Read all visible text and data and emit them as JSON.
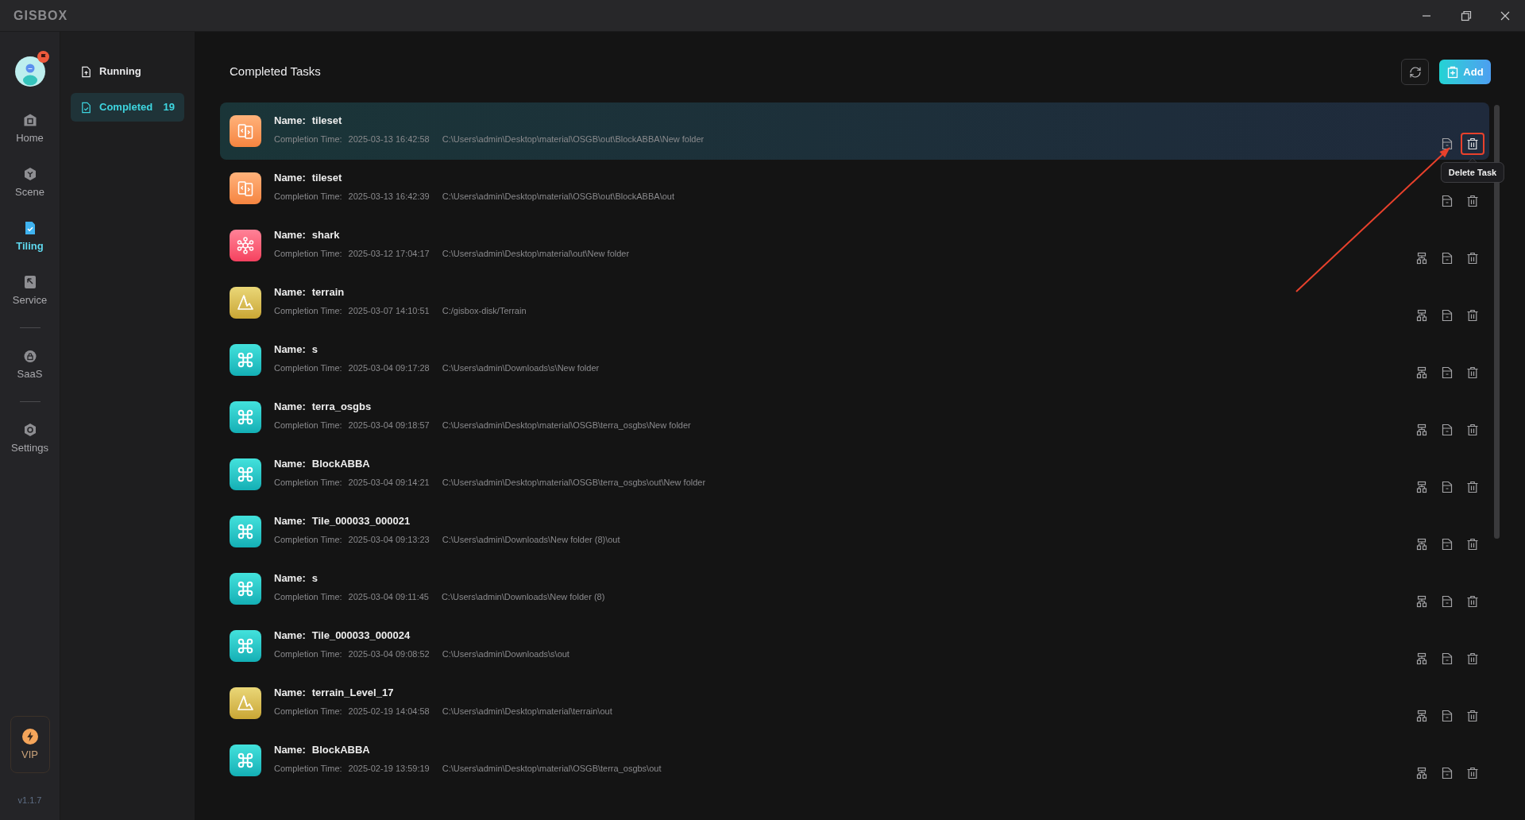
{
  "window": {
    "logo": "GISBOX"
  },
  "nav": {
    "groups": [
      {
        "items": [
          {
            "label": "Home",
            "selected": false
          },
          {
            "label": "Scene",
            "selected": false
          },
          {
            "label": "Tiling",
            "selected": true
          },
          {
            "label": "Service",
            "selected": false
          }
        ]
      },
      {
        "items": [
          {
            "label": "SaaS",
            "selected": false
          }
        ]
      },
      {
        "items": [
          {
            "label": "Settings",
            "selected": false
          }
        ]
      }
    ],
    "vip": "VIP",
    "version": "v1.1.7"
  },
  "task_menu": [
    {
      "label": "Running",
      "selected": false
    },
    {
      "label": "Completed",
      "selected": true,
      "count": "19"
    }
  ],
  "page": {
    "title": "Completed Tasks",
    "add_button": "Add"
  },
  "tasks": [
    {
      "kind": "tileset",
      "selected": true,
      "callout": true,
      "delete_tooltip": "Delete Task",
      "name_label": "Name:",
      "name": "tileset",
      "time_label": "Completion Time:",
      "time": "2025-03-13 16:42:58",
      "path": "C:\\Users\\admin\\Desktop\\material\\OSGB\\out\\BlockABBA\\New folder"
    },
    {
      "kind": "tileset",
      "selected": false,
      "callout": false,
      "name_label": "Name:",
      "name": "tileset",
      "time_label": "Completion Time:",
      "time": "2025-03-13 16:42:39",
      "path": "C:\\Users\\admin\\Desktop\\material\\OSGB\\out\\BlockABBA\\out"
    },
    {
      "kind": "model",
      "selected": false,
      "callout": false,
      "name_label": "Name:",
      "name": "shark",
      "time_label": "Completion Time:",
      "time": "2025-03-12 17:04:17",
      "path": "C:\\Users\\admin\\Desktop\\material\\out\\New folder"
    },
    {
      "kind": "terrain",
      "selected": false,
      "callout": false,
      "name_label": "Name:",
      "name": "terrain",
      "time_label": "Completion Time:",
      "time": "2025-03-07 14:10:51",
      "path": "C:/gisbox-disk/Terrain"
    },
    {
      "kind": "oblique",
      "selected": false,
      "callout": false,
      "name_label": "Name:",
      "name": "s",
      "time_label": "Completion Time:",
      "time": "2025-03-04 09:17:28",
      "path": "C:\\Users\\admin\\Downloads\\s\\New folder"
    },
    {
      "kind": "oblique",
      "selected": false,
      "callout": false,
      "name_label": "Name:",
      "name": "terra_osgbs",
      "time_label": "Completion Time:",
      "time": "2025-03-04 09:18:57",
      "path": "C:\\Users\\admin\\Desktop\\material\\OSGB\\terra_osgbs\\New folder"
    },
    {
      "kind": "oblique",
      "selected": false,
      "callout": false,
      "name_label": "Name:",
      "name": "BlockABBA",
      "time_label": "Completion Time:",
      "time": "2025-03-04 09:14:21",
      "path": "C:\\Users\\admin\\Desktop\\material\\OSGB\\terra_osgbs\\out\\New folder"
    },
    {
      "kind": "oblique",
      "selected": false,
      "callout": false,
      "name_label": "Name:",
      "name": "Tile_000033_000021",
      "time_label": "Completion Time:",
      "time": "2025-03-04 09:13:23",
      "path": "C:\\Users\\admin\\Downloads\\New folder (8)\\out"
    },
    {
      "kind": "oblique",
      "selected": false,
      "callout": false,
      "name_label": "Name:",
      "name": "s",
      "time_label": "Completion Time:",
      "time": "2025-03-04 09:11:45",
      "path": "C:\\Users\\admin\\Downloads\\New folder (8)"
    },
    {
      "kind": "oblique",
      "selected": false,
      "callout": false,
      "name_label": "Name:",
      "name": "Tile_000033_000024",
      "time_label": "Completion Time:",
      "time": "2025-03-04 09:08:52",
      "path": "C:\\Users\\admin\\Downloads\\s\\out"
    },
    {
      "kind": "terrain",
      "selected": false,
      "callout": false,
      "name_label": "Name:",
      "name": "terrain_Level_17",
      "time_label": "Completion Time:",
      "time": "2025-02-19 14:04:58",
      "path": "C:\\Users\\admin\\Desktop\\material\\terrain\\out"
    },
    {
      "kind": "oblique",
      "selected": false,
      "callout": false,
      "name_label": "Name:",
      "name": "BlockABBA",
      "time_label": "Completion Time:",
      "time": "2025-02-19 13:59:19",
      "path": "C:\\Users\\admin\\Desktop\\material\\OSGB\\terra_osgbs\\out"
    }
  ]
}
